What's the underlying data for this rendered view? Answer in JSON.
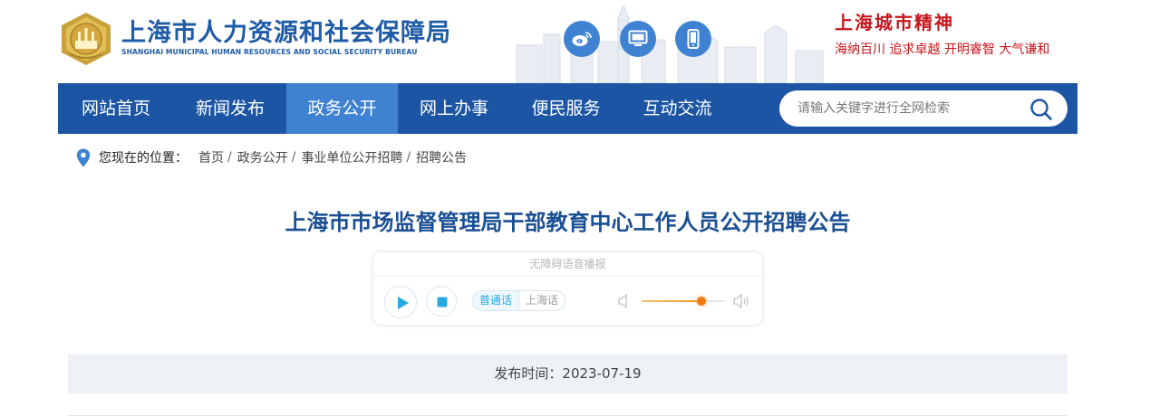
{
  "header": {
    "logo_title": "上海市人力资源和社会保障局",
    "logo_subtitle": "SHANGHAI MUNICIPAL HUMAN RESOURCES AND SOCIAL SECURITY BUREAU",
    "icons": [
      "weibo-icon",
      "monitor-icon",
      "mobile-icon"
    ],
    "spirit_title": "上海城市精神",
    "spirit_subtitle": "海纳百川 追求卓越 开明睿智 大气谦和"
  },
  "nav": {
    "items": [
      {
        "label": "网站首页",
        "active": false
      },
      {
        "label": "新闻发布",
        "active": false
      },
      {
        "label": "政务公开",
        "active": true
      },
      {
        "label": "网上办事",
        "active": false
      },
      {
        "label": "便民服务",
        "active": false
      },
      {
        "label": "互动交流",
        "active": false
      }
    ],
    "search_placeholder": "请输入关键字进行全网检索"
  },
  "breadcrumb": {
    "label": "您现在的位置：",
    "items": [
      "首页",
      "政务公开",
      "事业单位公开招聘",
      "招聘公告"
    ],
    "separator": "/"
  },
  "article": {
    "title": "上海市市场监督管理局干部教育中心工作人员公开招聘公告",
    "publish_label": "发布时间：",
    "publish_date": "2023-07-19"
  },
  "audio": {
    "header": "无障碍语音播报",
    "lang_active": "普通话",
    "lang_other": "上海话",
    "volume": 0.72
  },
  "colors": {
    "brand_blue": "#1c55a3",
    "nav_active": "#3f82d1",
    "title_blue": "#1a4f93",
    "spirit_red": "#c7161c",
    "volume_orange": "#f07a12"
  }
}
